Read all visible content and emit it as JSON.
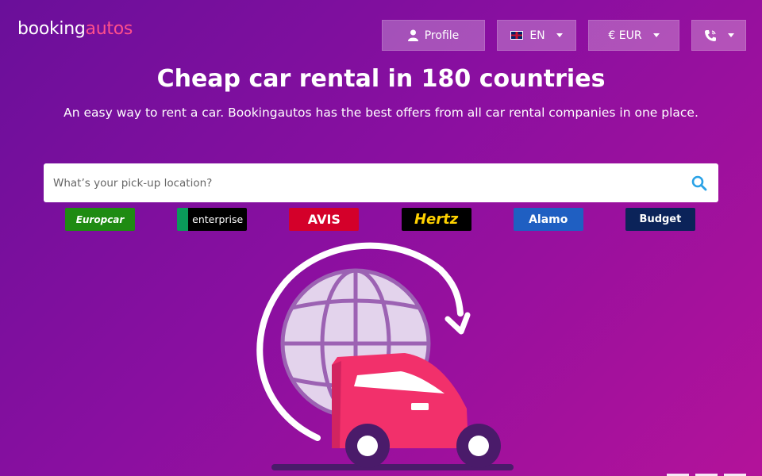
{
  "logo": {
    "part1": "booking",
    "part2": "autos"
  },
  "nav": {
    "profile": "Profile",
    "language": "EN",
    "currency": "€ EUR",
    "phone_icon": "phone-icon"
  },
  "hero": {
    "title": "Cheap car rental in 180 countries",
    "subtitle": "An easy way to rent a car. Bookingautos has the best offers from all car rental companies in one place."
  },
  "search": {
    "placeholder": "What’s your pick-up location?",
    "icon": "search-icon"
  },
  "brands": [
    "Europcar",
    "enterprise",
    "AVIS",
    "Hertz",
    "Alamo",
    "Budget"
  ],
  "colors": {
    "accent": "#ff4f8b",
    "search_icon": "#2aa2e6",
    "car_body": "#f2306b"
  }
}
